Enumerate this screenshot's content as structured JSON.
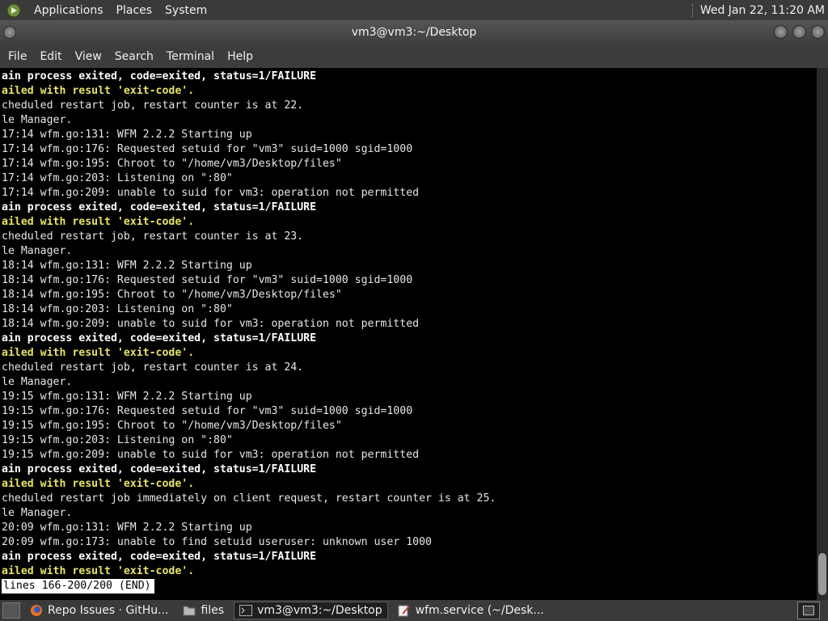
{
  "top_panel": {
    "menus": [
      "Applications",
      "Places",
      "System"
    ],
    "clock": "Wed Jan 22, 11:20 AM"
  },
  "window": {
    "title": "vm3@vm3:~/Desktop"
  },
  "menubar": [
    "File",
    "Edit",
    "View",
    "Search",
    "Terminal",
    "Help"
  ],
  "terminal": {
    "lines": [
      {
        "text": "ain process exited, code=exited, status=1/FAILURE",
        "style": "bold"
      },
      {
        "text": "ailed with result 'exit-code'.",
        "style": "warn"
      },
      {
        "text": "cheduled restart job, restart counter is at 22.",
        "style": "normal"
      },
      {
        "text": "le Manager.",
        "style": "normal"
      },
      {
        "text": "17:14 wfm.go:131: WFM 2.2.2 Starting up",
        "style": "normal"
      },
      {
        "text": "17:14 wfm.go:176: Requested setuid for \"vm3\" suid=1000 sgid=1000",
        "style": "normal"
      },
      {
        "text": "17:14 wfm.go:195: Chroot to \"/home/vm3/Desktop/files\"",
        "style": "normal"
      },
      {
        "text": "17:14 wfm.go:203: Listening on \":80\"",
        "style": "normal"
      },
      {
        "text": "17:14 wfm.go:209: unable to suid for vm3: operation not permitted",
        "style": "normal"
      },
      {
        "text": "ain process exited, code=exited, status=1/FAILURE",
        "style": "bold"
      },
      {
        "text": "ailed with result 'exit-code'.",
        "style": "warn"
      },
      {
        "text": "cheduled restart job, restart counter is at 23.",
        "style": "normal"
      },
      {
        "text": "le Manager.",
        "style": "normal"
      },
      {
        "text": "18:14 wfm.go:131: WFM 2.2.2 Starting up",
        "style": "normal"
      },
      {
        "text": "18:14 wfm.go:176: Requested setuid for \"vm3\" suid=1000 sgid=1000",
        "style": "normal"
      },
      {
        "text": "18:14 wfm.go:195: Chroot to \"/home/vm3/Desktop/files\"",
        "style": "normal"
      },
      {
        "text": "18:14 wfm.go:203: Listening on \":80\"",
        "style": "normal"
      },
      {
        "text": "18:14 wfm.go:209: unable to suid for vm3: operation not permitted",
        "style": "normal"
      },
      {
        "text": "ain process exited, code=exited, status=1/FAILURE",
        "style": "bold"
      },
      {
        "text": "ailed with result 'exit-code'.",
        "style": "warn"
      },
      {
        "text": "cheduled restart job, restart counter is at 24.",
        "style": "normal"
      },
      {
        "text": "le Manager.",
        "style": "normal"
      },
      {
        "text": "19:15 wfm.go:131: WFM 2.2.2 Starting up",
        "style": "normal"
      },
      {
        "text": "19:15 wfm.go:176: Requested setuid for \"vm3\" suid=1000 sgid=1000",
        "style": "normal"
      },
      {
        "text": "19:15 wfm.go:195: Chroot to \"/home/vm3/Desktop/files\"",
        "style": "normal"
      },
      {
        "text": "19:15 wfm.go:203: Listening on \":80\"",
        "style": "normal"
      },
      {
        "text": "19:15 wfm.go:209: unable to suid for vm3: operation not permitted",
        "style": "normal"
      },
      {
        "text": "ain process exited, code=exited, status=1/FAILURE",
        "style": "bold"
      },
      {
        "text": "ailed with result 'exit-code'.",
        "style": "warn"
      },
      {
        "text": "cheduled restart job immediately on client request, restart counter is at 25.",
        "style": "normal"
      },
      {
        "text": "le Manager.",
        "style": "normal"
      },
      {
        "text": "20:09 wfm.go:131: WFM 2.2.2 Starting up",
        "style": "normal"
      },
      {
        "text": "20:09 wfm.go:173: unable to find setuid useruser: unknown user 1000",
        "style": "normal"
      },
      {
        "text": "ain process exited, code=exited, status=1/FAILURE",
        "style": "bold"
      },
      {
        "text": "ailed with result 'exit-code'.",
        "style": "warn"
      }
    ],
    "status_line": "lines 166-200/200 (END)"
  },
  "taskbar": {
    "tasks": [
      {
        "label": "Repo Issues · GitHu...",
        "icon": "firefox-icon",
        "active": false
      },
      {
        "label": "files",
        "icon": "folder-icon",
        "active": false
      },
      {
        "label": "vm3@vm3:~/Desktop",
        "icon": "terminal-icon",
        "active": true
      },
      {
        "label": "wfm.service (~/Desk...",
        "icon": "text-editor-icon",
        "active": false
      }
    ]
  },
  "colors": {
    "panel_bg": "#3a3a3a",
    "terminal_bg": "#000000",
    "terminal_fg": "#e6e6e6",
    "warn_fg": "#e8e36a"
  }
}
